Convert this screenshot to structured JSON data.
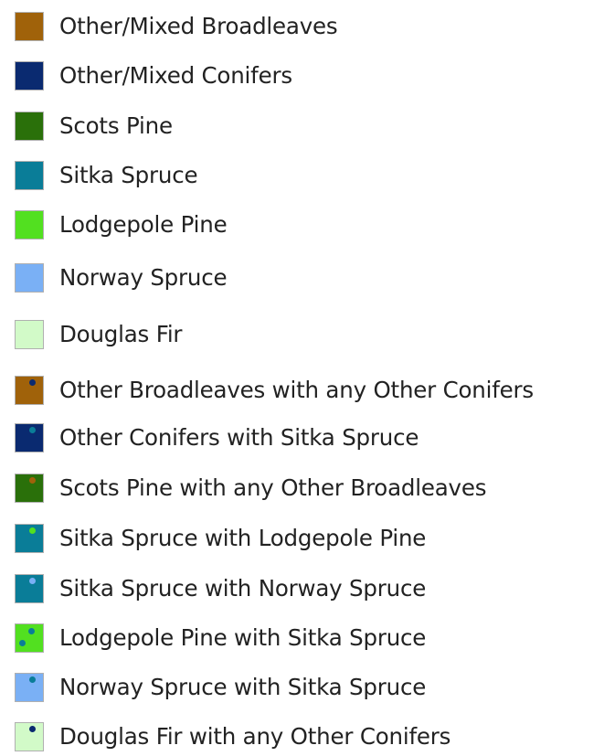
{
  "legend": {
    "items": [
      {
        "label": "Other/Mixed Broadleaves",
        "color": "#a0620a",
        "dots": []
      },
      {
        "label": "Other/Mixed Conifers",
        "color": "#0a2a70",
        "dots": []
      },
      {
        "label": "Scots Pine",
        "color": "#2a700a",
        "dots": []
      },
      {
        "label": "Sitka Spruce",
        "color": "#0a7d98",
        "dots": []
      },
      {
        "label": "Lodgepole Pine",
        "color": "#52e020",
        "dots": []
      },
      {
        "label": "Norway Spruce",
        "color": "#7ab0f5",
        "dots": []
      },
      {
        "label": "Douglas Fir",
        "color": "#d2fac8",
        "dots": []
      },
      {
        "label": "Other Broadleaves with any Other Conifers",
        "color": "#a0620a",
        "dots": [
          "#0a2a70"
        ]
      },
      {
        "label": "Other Conifers with Sitka Spruce",
        "color": "#0a2a70",
        "dots": [
          "#0a7d98"
        ]
      },
      {
        "label": "Scots Pine with any Other Broadleaves",
        "color": "#2a700a",
        "dots": [
          "#a0620a"
        ]
      },
      {
        "label": "Sitka Spruce with Lodgepole Pine",
        "color": "#0a7d98",
        "dots": [
          "#52e020"
        ]
      },
      {
        "label": "Sitka Spruce with Norway Spruce",
        "color": "#0a7d98",
        "dots": [
          "#7ab0f5"
        ]
      },
      {
        "label": "Lodgepole Pine with Sitka Spruce",
        "color": "#52e020",
        "dots": [
          "#0a7d98",
          "#0a7d98"
        ]
      },
      {
        "label": "Norway Spruce with Sitka Spruce",
        "color": "#7ab0f5",
        "dots": [
          "#0a7d98"
        ]
      },
      {
        "label": "Douglas Fir with any Other Conifers",
        "color": "#d2fac8",
        "dots": [
          "#0a2a70"
        ]
      }
    ]
  }
}
